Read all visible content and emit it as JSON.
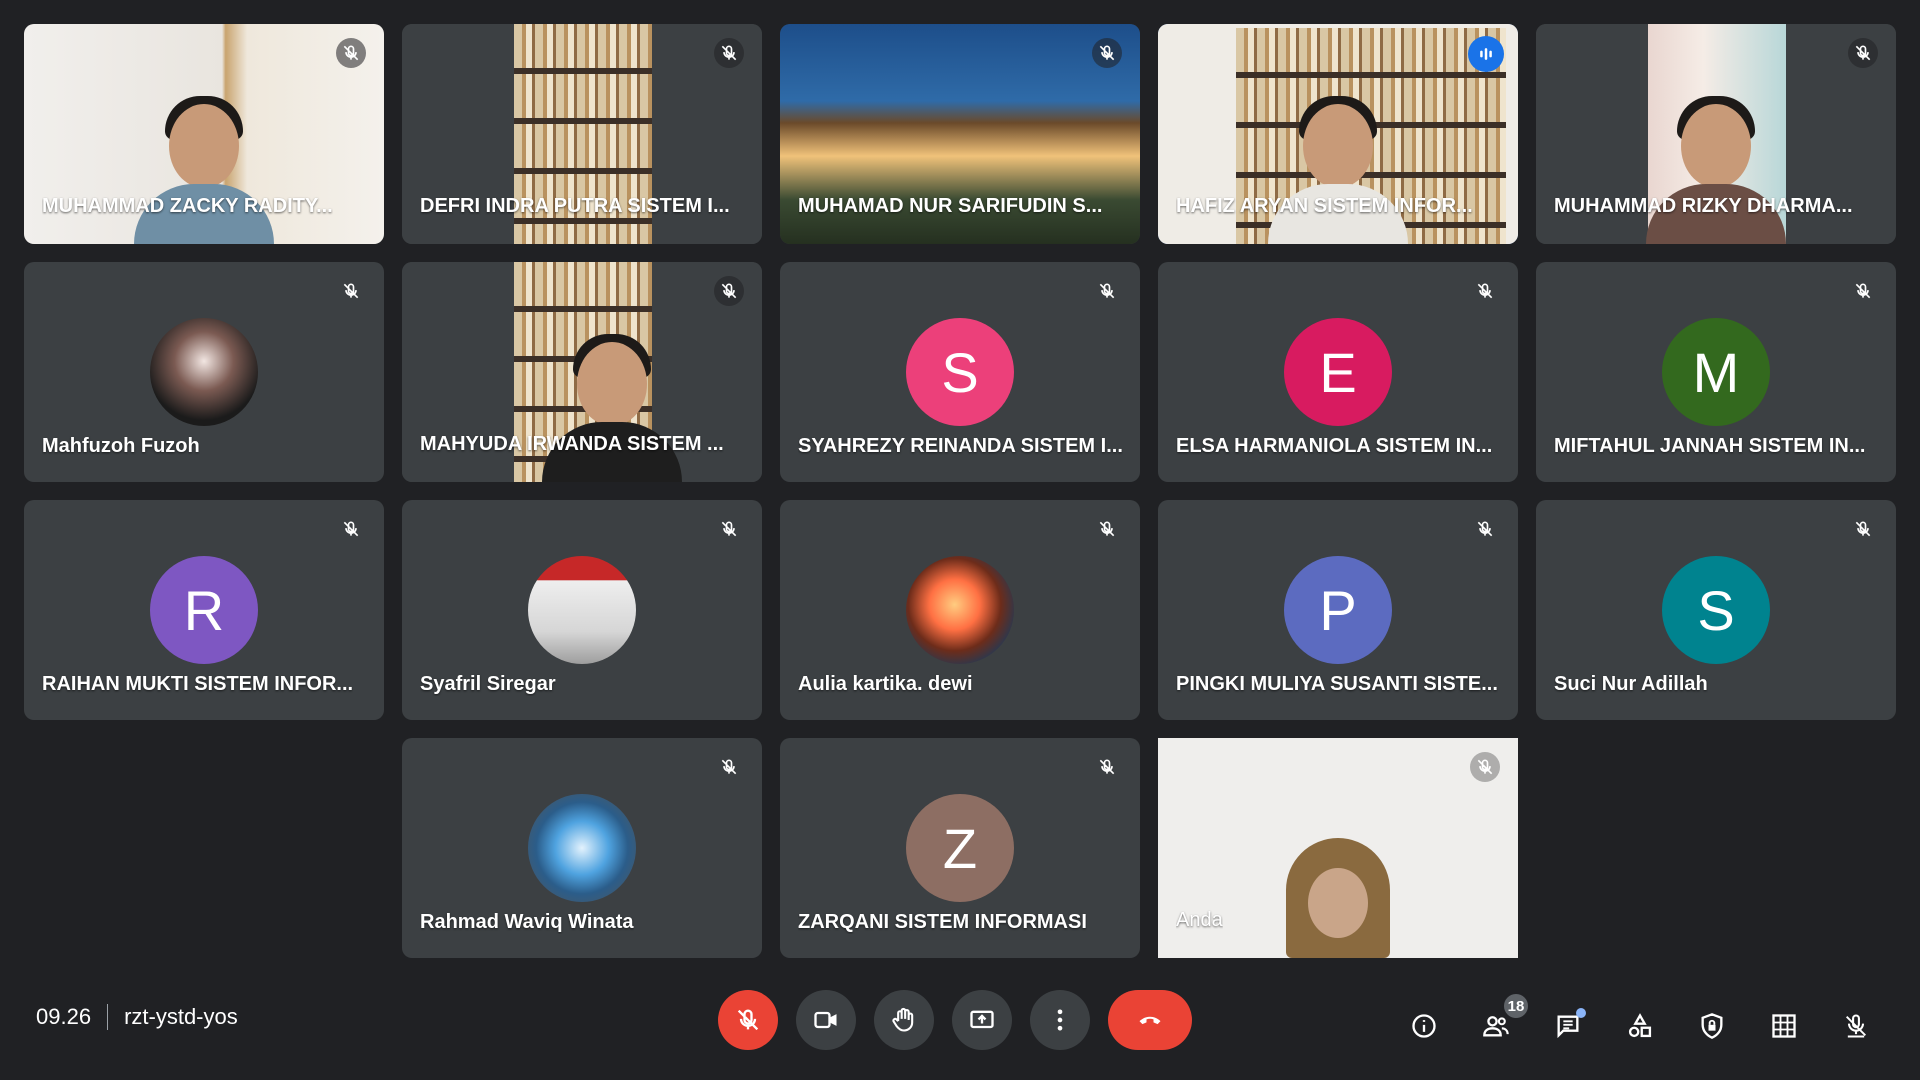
{
  "meeting": {
    "time": "09.26",
    "code": "rzt-ystd-yos",
    "participant_count": "18"
  },
  "tiles": [
    {
      "name": "MUHAMMAD ZACKY RADITY...",
      "type": "video"
    },
    {
      "name": "DEFRI INDRA PUTRA SISTEM I...",
      "type": "video"
    },
    {
      "name": "MUHAMAD NUR SARIFUDIN S...",
      "type": "video"
    },
    {
      "name": "HAFIZ ARYAN SISTEM INFOR...",
      "type": "video",
      "speaking": true
    },
    {
      "name": "MUHAMMAD RIZKY DHARMA...",
      "type": "video"
    },
    {
      "name": "Mahfuzoh Fuzoh",
      "type": "avatar-image"
    },
    {
      "name": "MAHYUDA IRWANDA SISTEM ...",
      "type": "video"
    },
    {
      "name": "SYAHREZY REINANDA SISTEM I...",
      "type": "letter",
      "letter": "S",
      "color": "#ec407a"
    },
    {
      "name": "ELSA HARMANIOLA SISTEM IN...",
      "type": "letter",
      "letter": "E",
      "color": "#d81b60"
    },
    {
      "name": "MIFTAHUL JANNAH SISTEM IN...",
      "type": "letter",
      "letter": "M",
      "color": "#33691e"
    },
    {
      "name": "RAIHAN MUKTI SISTEM INFOR...",
      "type": "letter",
      "letter": "R",
      "color": "#7e57c2"
    },
    {
      "name": "Syafril Siregar",
      "type": "avatar-image"
    },
    {
      "name": "Aulia kartika. dewi",
      "type": "avatar-image"
    },
    {
      "name": "PINGKI MULIYA SUSANTI SISTE...",
      "type": "letter",
      "letter": "P",
      "color": "#5c6bc0"
    },
    {
      "name": "Suci Nur Adillah",
      "type": "letter",
      "letter": "S",
      "color": "#00838f"
    },
    {
      "name": "Rahmad Waviq Winata",
      "type": "avatar-image"
    },
    {
      "name": "ZARQANI SISTEM INFORMASI",
      "type": "letter",
      "letter": "Z",
      "color": "#8d6e63"
    },
    {
      "name": "Anda",
      "type": "video",
      "self": true
    }
  ],
  "controls": {
    "center": [
      "mic-off-icon",
      "camera-icon",
      "raise-hand-icon",
      "present-screen-icon",
      "more-options-icon",
      "end-call-icon"
    ],
    "right": [
      "info-icon",
      "people-icon",
      "chat-icon",
      "activities-icon",
      "host-controls-icon",
      "grid-layout-icon",
      "captions-mic-icon"
    ]
  },
  "colors": {
    "background": "#202124",
    "tile": "#3c4043",
    "mic_off": "#ea4335",
    "speaking_border": "#8ab4f8"
  }
}
